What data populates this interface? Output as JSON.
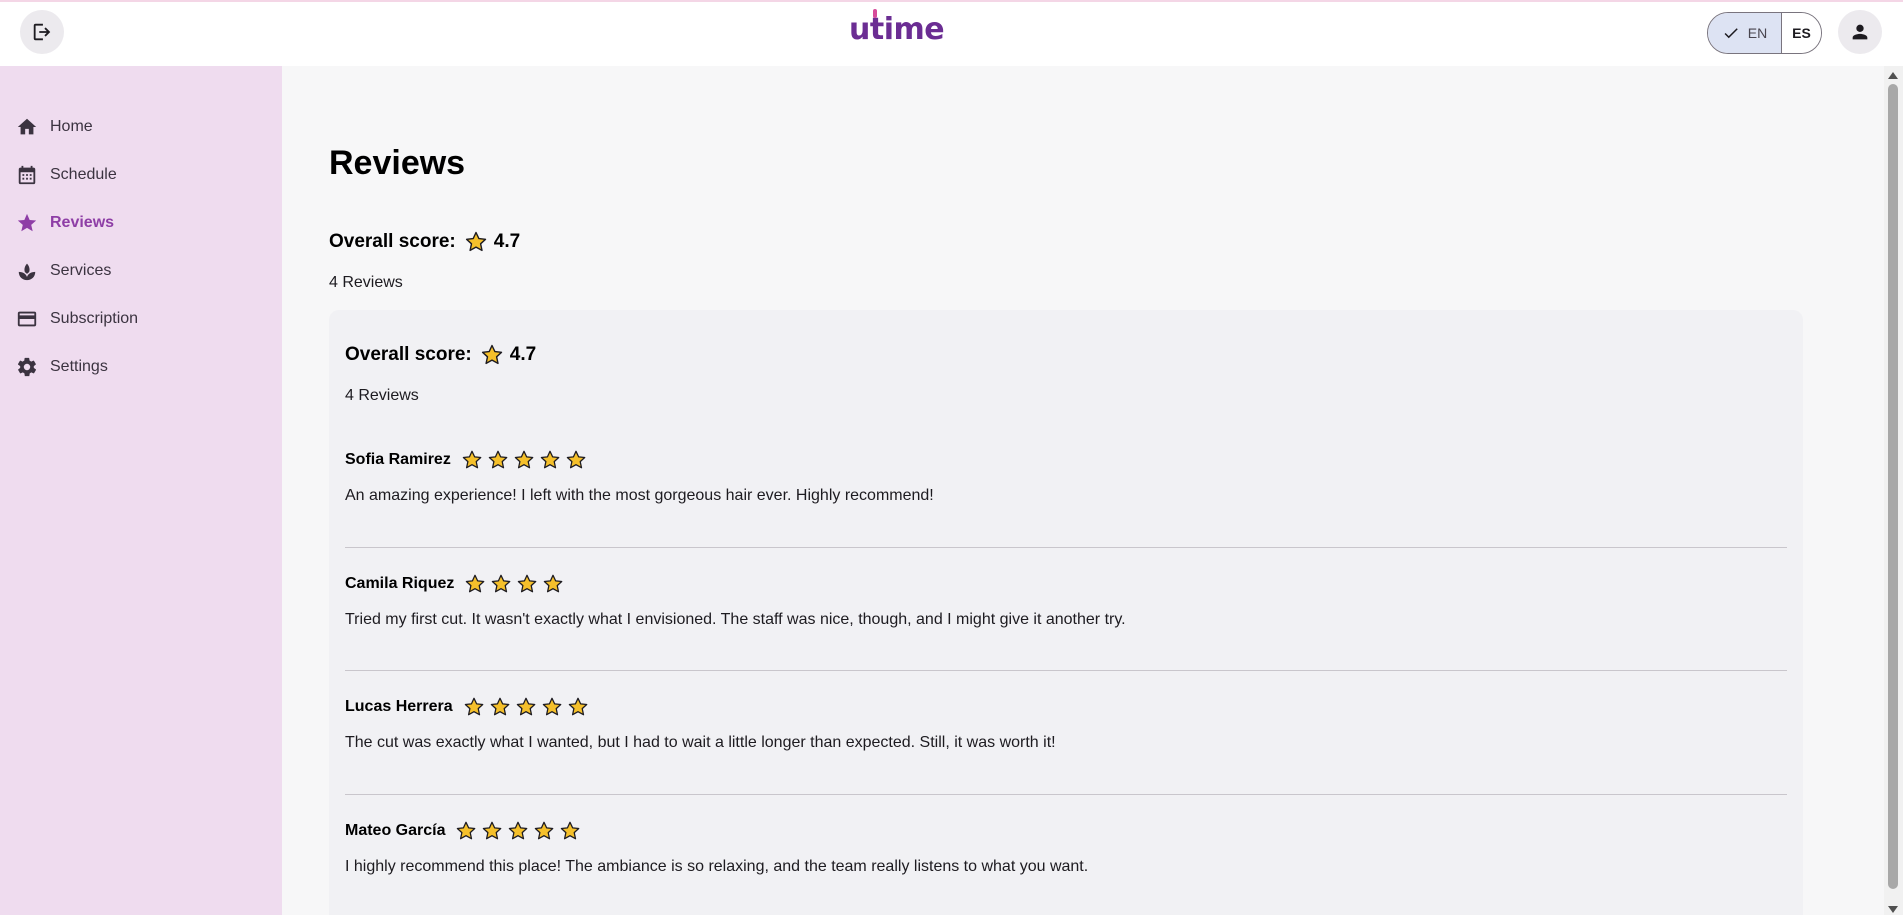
{
  "app": {
    "logo_text_a": "u",
    "logo_text_b": "t",
    "logo_text_c": "ime"
  },
  "header": {
    "language": {
      "options": [
        {
          "label": "EN",
          "selected": true
        },
        {
          "label": "ES",
          "selected": false
        }
      ]
    },
    "icons": {
      "logout": "logout-icon",
      "profile": "person-icon",
      "check": "check-icon"
    }
  },
  "sidebar": {
    "items": [
      {
        "label": "Home",
        "icon": "home-icon",
        "active": false
      },
      {
        "label": "Schedule",
        "icon": "calendar-icon",
        "active": false
      },
      {
        "label": "Reviews",
        "icon": "star-icon",
        "active": true
      },
      {
        "label": "Services",
        "icon": "spa-icon",
        "active": false
      },
      {
        "label": "Subscription",
        "icon": "card-icon",
        "active": false
      },
      {
        "label": "Settings",
        "icon": "gear-icon",
        "active": false
      }
    ]
  },
  "page": {
    "title": "Reviews",
    "summary": {
      "label": "Overall score:",
      "score": "4.7",
      "count": "4 Reviews"
    },
    "card_summary": {
      "label": "Overall score:",
      "score": "4.7",
      "count": "4 Reviews"
    },
    "reviews": [
      {
        "name": "Sofia Ramirez",
        "rating": 5,
        "text": "An amazing experience! I left with the most gorgeous hair ever. Highly recommend!"
      },
      {
        "name": "Camila Riquez",
        "rating": 4,
        "text": "Tried my first cut. It wasn't exactly what I envisioned. The staff was nice, though, and I might give it another try."
      },
      {
        "name": "Lucas Herrera",
        "rating": 5,
        "text": "The cut was exactly what I wanted, but I had to wait a little longer than expected. Still, it was worth it!"
      },
      {
        "name": "Mateo García",
        "rating": 5,
        "text": "I highly recommend this place! The ambiance is so relaxing, and the team really listens to what you want."
      }
    ]
  },
  "colors": {
    "accent": "#8e3ea6",
    "sidebar_bg": "#efdcef",
    "star_fill": "#f5c02b",
    "logo": "#6b2d93"
  }
}
